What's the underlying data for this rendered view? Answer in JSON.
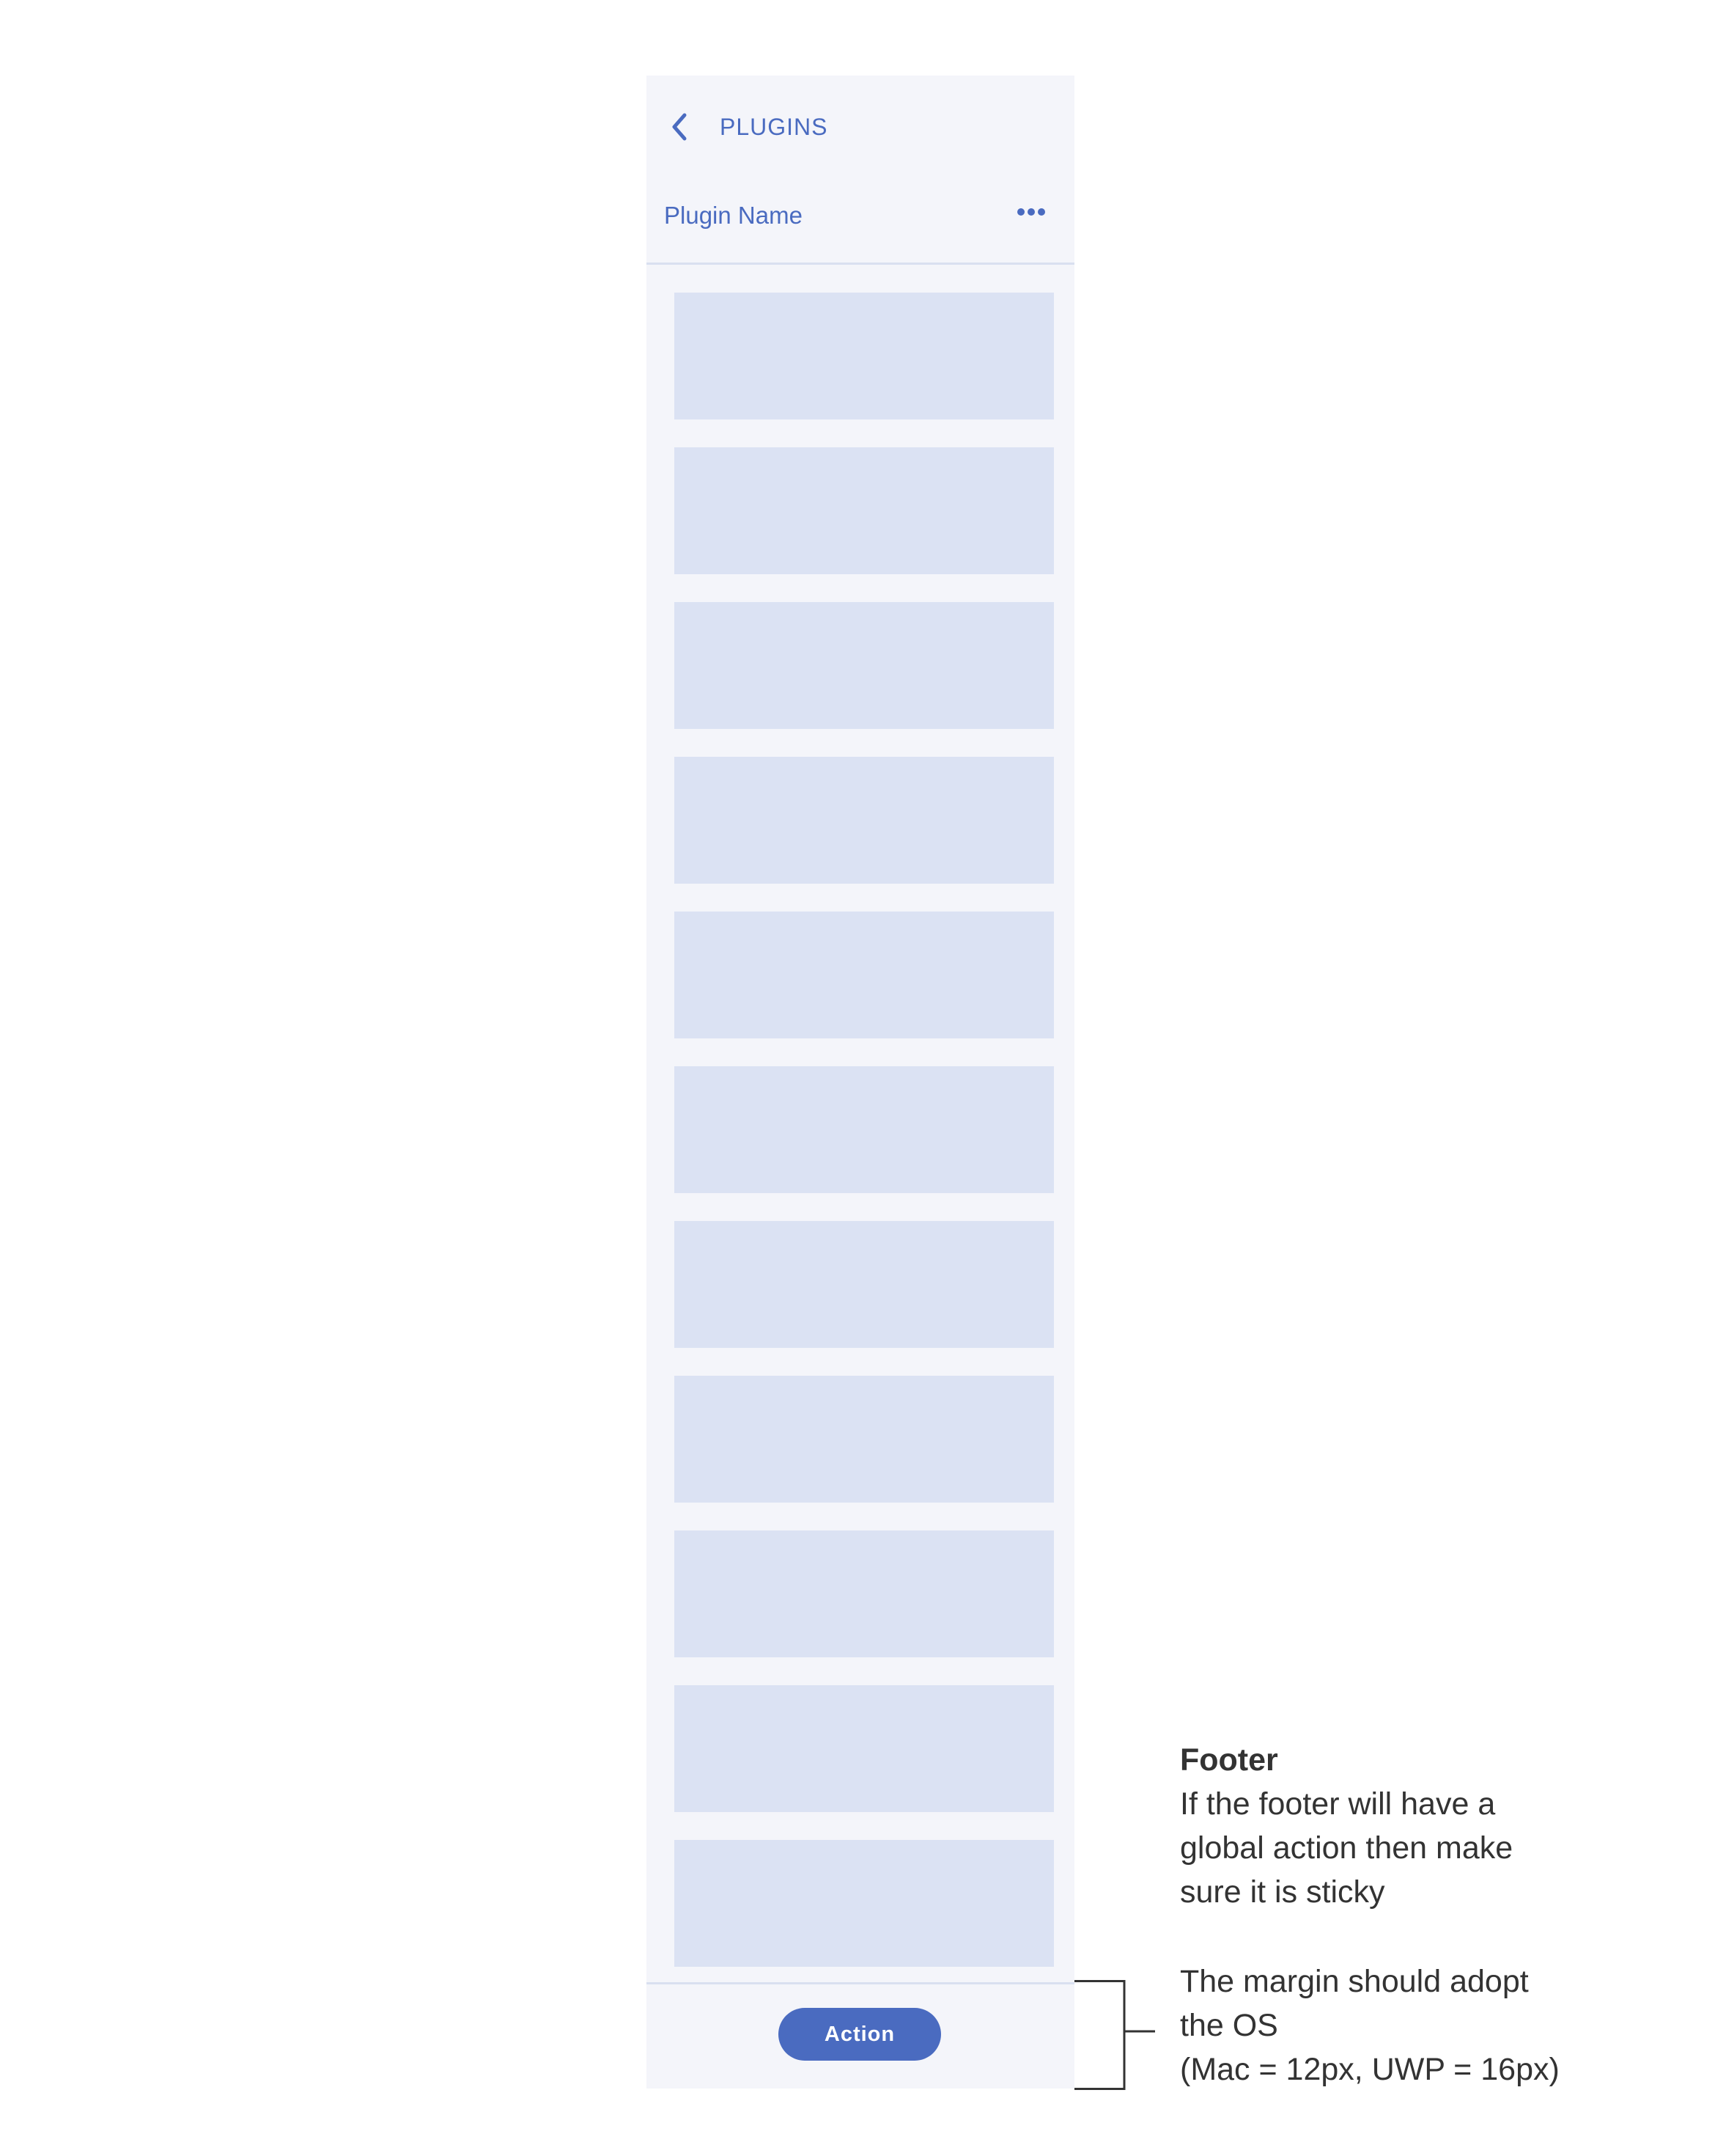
{
  "nav": {
    "back_label": "PLUGINS"
  },
  "header": {
    "plugin_name": "Plugin Name"
  },
  "list": {
    "item_count": 11
  },
  "footer": {
    "action_label": "Action"
  },
  "annotations": {
    "footer_title": "Footer",
    "footer_lines": [
      "If the footer will have a",
      "global action then make",
      "sure it is sticky"
    ],
    "margin_lines": [
      "The margin should adopt",
      "the OS",
      "(Mac = 12px, UWP = 16px)"
    ]
  },
  "colors": {
    "accent": "#4a6bc0",
    "panel_bg": "#f4f5fa",
    "placeholder": "#dbe2f3",
    "divider": "#d9e0f0",
    "annotation_text": "#333333"
  }
}
